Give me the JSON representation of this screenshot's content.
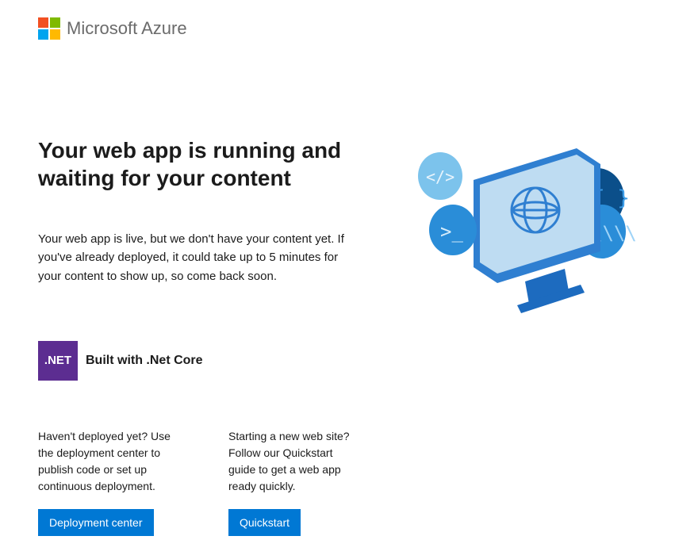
{
  "header": {
    "title": "Microsoft Azure"
  },
  "main": {
    "title": "Your web app is running and waiting for your content",
    "description": "Your web app is live, but we don't have your content yet. If you've already deployed, it could take up to 5 minutes for your content to show up, so come back soon."
  },
  "built_with": {
    "badge": ".NET",
    "label": "Built with .Net Core"
  },
  "cards": [
    {
      "text": "Haven't deployed yet? Use the deployment center to publish code or set up continuous deployment.",
      "button": "Deployment center"
    },
    {
      "text": "Starting a new web site? Follow our Quickstart guide to get a web app ready quickly.",
      "button": "Quickstart"
    }
  ],
  "colors": {
    "accent": "#0078d4",
    "net_purple": "#5c2d91"
  }
}
